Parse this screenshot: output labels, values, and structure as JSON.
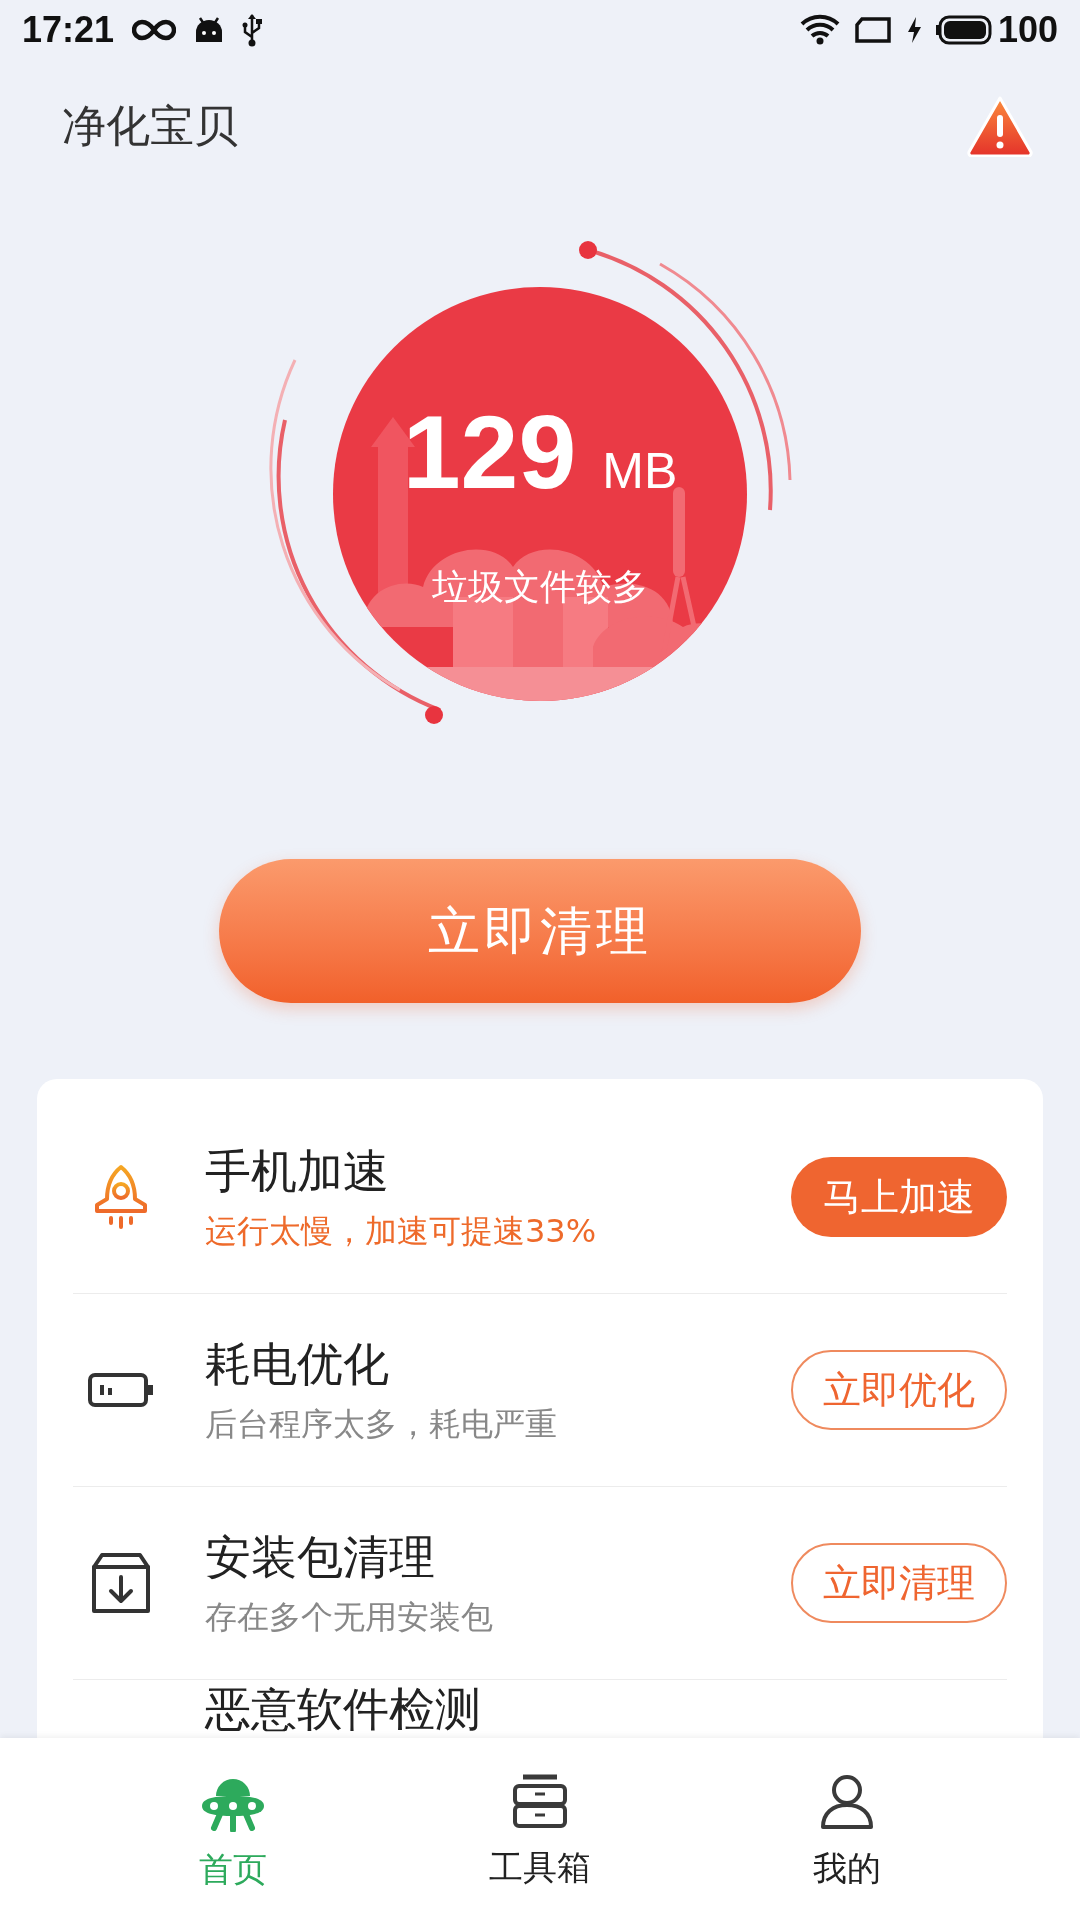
{
  "status_bar": {
    "time": "17:21",
    "battery": "100"
  },
  "app_bar": {
    "title": "净化宝贝"
  },
  "gauge": {
    "value": "129",
    "unit": "MB",
    "caption": "垃圾文件较多"
  },
  "primary_button": {
    "label": "立即清理"
  },
  "features": [
    {
      "kind": "rocket",
      "title": "手机加速",
      "subtitle": "运行太慢，加速可提速33%",
      "warning": true,
      "action": {
        "label": "马上加速",
        "filled": true
      }
    },
    {
      "kind": "battery",
      "title": "耗电优化",
      "subtitle": "后台程序太多，耗电严重",
      "warning": false,
      "action": {
        "label": "立即优化",
        "filled": false
      }
    },
    {
      "kind": "package",
      "title": "安装包清理",
      "subtitle": "存在多个无用安装包",
      "warning": false,
      "action": {
        "label": "立即清理",
        "filled": false
      }
    },
    {
      "kind": "partial",
      "title": "恶意软件检测"
    }
  ],
  "bottom_nav": [
    {
      "kind": "home",
      "label": "首页",
      "selected": true
    },
    {
      "kind": "toolbox",
      "label": "工具箱",
      "selected": false
    },
    {
      "kind": "profile",
      "label": "我的",
      "selected": false
    }
  ]
}
